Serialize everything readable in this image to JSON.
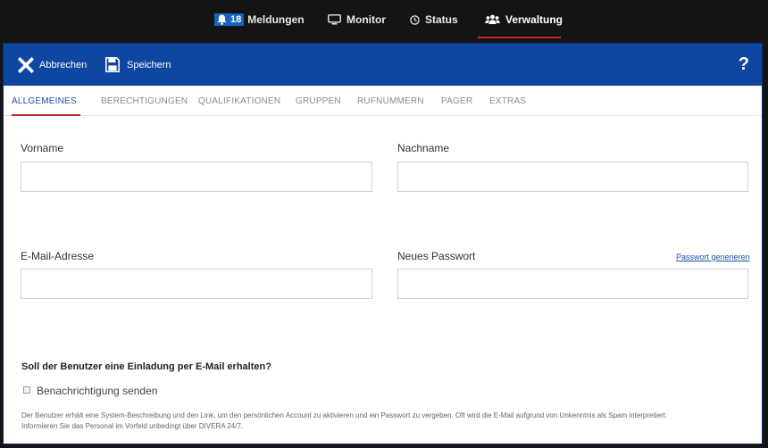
{
  "topnav": {
    "meldungen": {
      "count": "18",
      "label": "Meldungen"
    },
    "monitor": {
      "label": "Monitor"
    },
    "status": {
      "label": "Status"
    },
    "verwaltung": {
      "label": "Verwaltung"
    }
  },
  "toolbar": {
    "cancel_label": "Abbrechen",
    "save_label": "Speichern",
    "help_label": "?"
  },
  "tabs": [
    {
      "label": "ALLGEMEINES",
      "active": true
    },
    {
      "label": "BERECHTIGUNGEN"
    },
    {
      "label": "QUALIFIKATIONEN"
    },
    {
      "label": "GRUPPEN"
    },
    {
      "label": "RUFNUMMERN"
    },
    {
      "label": "PAGER"
    },
    {
      "label": "EXTRAS"
    }
  ],
  "form": {
    "firstname": {
      "label": "Vorname",
      "value": ""
    },
    "lastname": {
      "label": "Nachname",
      "value": ""
    },
    "email": {
      "label": "E-Mail-Adresse",
      "value": ""
    },
    "password": {
      "label": "Neues Passwort",
      "value": "",
      "generate_link": "Passwort generieren"
    },
    "invite_question": "Soll der Benutzer eine Einladung per E-Mail erhalten?",
    "notify_label": "Benachrichtigung senden",
    "notify_checked": false,
    "description_line1": "Der Benutzer erhält eine System-Beschreibung und den Link, um den persönlichen Account zu aktivieren und ein Passwort zu vergeben. Oft wird die E-Mail aufgrund von Unkenntnis als Spam interpretiert.",
    "description_line2": "Informieren Sie das Personal im Vorfeld unbedingt über DIVERA 24/7."
  },
  "colors": {
    "primary": "#0d47a1",
    "accent_red": "#c62828",
    "tab_active": "#1f4fa8"
  },
  "icons": [
    "bell-icon",
    "monitor-icon",
    "clock-icon",
    "users-icon",
    "close-icon",
    "save-icon",
    "help-icon"
  ]
}
